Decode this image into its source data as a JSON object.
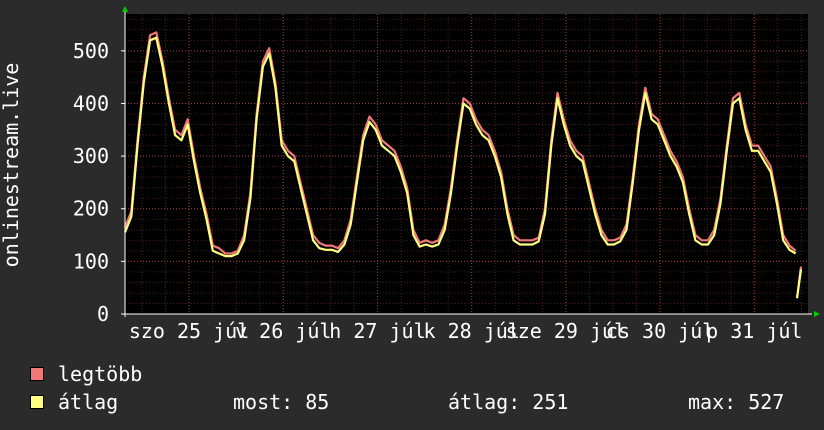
{
  "chart_data": {
    "type": "line",
    "ylabel": "onlinestream.live",
    "ylim": [
      0,
      570
    ],
    "yticks": [
      0,
      100,
      200,
      300,
      400,
      500
    ],
    "grid": true,
    "xtick_labels": [
      "szo 25 júl",
      "v 26 júl",
      "h 27 júl",
      "k 28 júl",
      "sze 29 júl",
      "cs 30 júl",
      "p 31 júl"
    ],
    "series": [
      {
        "name": "legtöbb",
        "color": "#f07878",
        "values": [
          165,
          195,
          330,
          450,
          530,
          535,
          480,
          410,
          350,
          340,
          370,
          300,
          240,
          190,
          130,
          125,
          115,
          115,
          120,
          150,
          230,
          380,
          480,
          505,
          440,
          330,
          310,
          300,
          250,
          200,
          150,
          135,
          130,
          130,
          125,
          140,
          180,
          260,
          340,
          375,
          360,
          330,
          320,
          310,
          280,
          240,
          160,
          135,
          140,
          135,
          140,
          170,
          240,
          330,
          410,
          400,
          370,
          350,
          340,
          310,
          270,
          200,
          150,
          140,
          140,
          140,
          145,
          200,
          330,
          420,
          370,
          330,
          310,
          300,
          250,
          200,
          160,
          140,
          140,
          145,
          170,
          260,
          360,
          430,
          380,
          370,
          340,
          310,
          290,
          260,
          200,
          150,
          140,
          140,
          160,
          220,
          320,
          410,
          420,
          360,
          320,
          320,
          300,
          280,
          220,
          150,
          130,
          120,
          90
        ]
      },
      {
        "name": "átlag",
        "color": "#ffff80",
        "values": [
          155,
          185,
          320,
          440,
          520,
          525,
          470,
          400,
          340,
          330,
          360,
          290,
          230,
          180,
          120,
          115,
          110,
          110,
          115,
          140,
          220,
          370,
          470,
          495,
          430,
          320,
          300,
          290,
          240,
          190,
          140,
          125,
          122,
          122,
          118,
          132,
          170,
          250,
          330,
          365,
          350,
          320,
          310,
          300,
          270,
          230,
          150,
          128,
          132,
          128,
          132,
          160,
          230,
          320,
          400,
          390,
          360,
          340,
          330,
          300,
          260,
          190,
          140,
          132,
          132,
          132,
          138,
          190,
          320,
          410,
          360,
          320,
          300,
          290,
          240,
          190,
          150,
          132,
          132,
          138,
          160,
          250,
          350,
          420,
          370,
          360,
          330,
          300,
          280,
          250,
          190,
          140,
          132,
          132,
          150,
          210,
          310,
          400,
          410,
          350,
          310,
          310,
          290,
          270,
          210,
          140,
          122,
          115,
          85
        ]
      }
    ],
    "gap_after_index": 107
  },
  "legend": [
    {
      "label": "legtöbb",
      "color": "#f07878"
    },
    {
      "label": "átlag",
      "color": "#ffff80"
    }
  ],
  "stats": {
    "now": "most: 85",
    "avg": "átlag: 251",
    "max": "max: 527"
  }
}
